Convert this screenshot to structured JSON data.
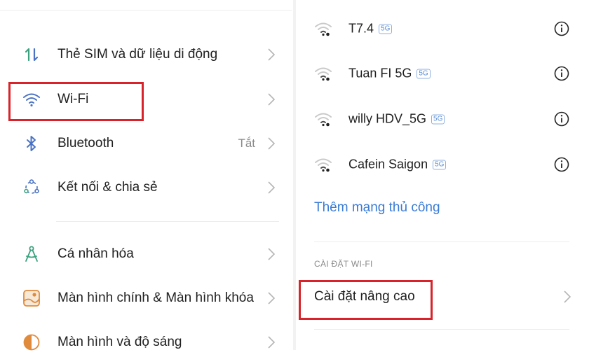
{
  "left_panel": {
    "items": [
      {
        "label": "Thẻ SIM và dữ liệu di động",
        "icon": "sim-data-icon"
      },
      {
        "label": "Wi-Fi",
        "icon": "wifi-icon"
      },
      {
        "label": "Bluetooth",
        "value": "Tắt",
        "icon": "bluetooth-icon"
      },
      {
        "label": "Kết nối & chia sẻ",
        "icon": "connection-share-icon"
      },
      {
        "label": "Cá nhân hóa",
        "icon": "personalization-icon"
      },
      {
        "label": "Màn hình chính & Màn hình khóa",
        "icon": "home-lock-screen-icon"
      },
      {
        "label": "Màn hình và độ sáng",
        "icon": "display-brightness-icon"
      }
    ]
  },
  "right_panel": {
    "networks": [
      {
        "name": "T7.4",
        "badge": "5G"
      },
      {
        "name": "Tuan FI 5G",
        "badge": "5G"
      },
      {
        "name": "willy HDV_5G",
        "badge": "5G"
      },
      {
        "name": "Cafein Saigon",
        "badge": "5G"
      }
    ],
    "add_network": "Thêm mạng thủ công",
    "section_title": "CÀI ĐẶT WI-FI",
    "advanced_settings": "Cài đặt nâng cao"
  },
  "colors": {
    "highlight": "#d8232a",
    "link_blue": "#3a7bd5",
    "icon_blue": "#4a72c4",
    "icon_green": "#3aa17e"
  }
}
